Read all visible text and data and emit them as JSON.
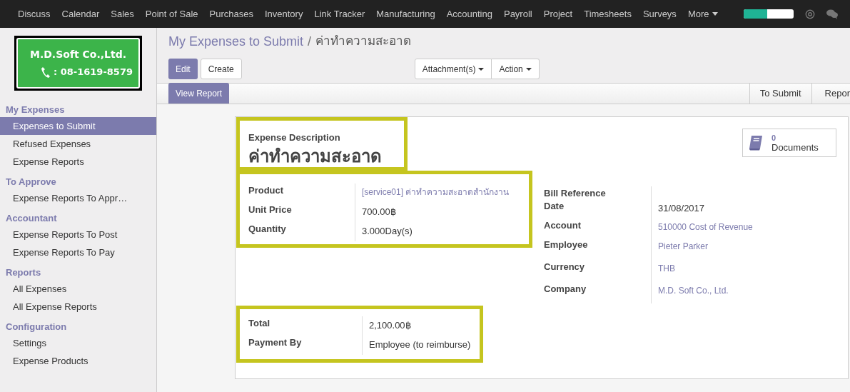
{
  "top_menu": {
    "items": [
      "Discuss",
      "Calendar",
      "Sales",
      "Point of Sale",
      "Purchases",
      "Inventory",
      "Link Tracker",
      "Manufacturing",
      "Accounting",
      "Payroll",
      "Project",
      "Timesheets",
      "Surveys"
    ],
    "more": "More",
    "progress": {
      "level": 0.48
    }
  },
  "logo": {
    "name": "M.D.Soft Co.,Ltd.",
    "phone": ": 08-1619-8579"
  },
  "sidebar": {
    "sections": [
      {
        "title": "My Expenses",
        "items": [
          {
            "label": "Expenses to Submit",
            "selected": true
          },
          {
            "label": "Refused Expenses",
            "selected": false
          },
          {
            "label": "Expense Reports",
            "selected": false
          }
        ]
      },
      {
        "title": "To Approve",
        "items": [
          {
            "label": "Expense Reports To Appr…",
            "selected": false
          }
        ]
      },
      {
        "title": "Accountant",
        "items": [
          {
            "label": "Expense Reports To Post",
            "selected": false
          },
          {
            "label": "Expense Reports To Pay",
            "selected": false
          }
        ]
      },
      {
        "title": "Reports",
        "items": [
          {
            "label": "All Expenses",
            "selected": false
          },
          {
            "label": "All Expense Reports",
            "selected": false
          }
        ]
      },
      {
        "title": "Configuration",
        "items": [
          {
            "label": "Settings",
            "selected": false
          },
          {
            "label": "Expense Products",
            "selected": false
          }
        ]
      }
    ]
  },
  "breadcrumb": {
    "parent": "My Expenses to Submit",
    "separator": "/",
    "current": "ค่าทำความสะอาด"
  },
  "buttons": {
    "edit": "Edit",
    "create": "Create",
    "dropdowns": [
      "Attachment(s)",
      "Action"
    ]
  },
  "statusbar": {
    "button": "View Report",
    "stages": [
      "To Submit",
      "Repor"
    ]
  },
  "form": {
    "description_label": "Expense Description",
    "description": "ค่าทำความสะอาด",
    "smart_button": {
      "count": "0",
      "label": "Documents"
    },
    "left_fields": [
      {
        "label": "Product",
        "value": "[service01] ค่าทำความสะอาดสำนักงาน",
        "kind": "link"
      },
      {
        "label": "Unit Price",
        "value": "700.00฿",
        "kind": "text"
      },
      {
        "label": "Quantity",
        "value": "3.000Day(s)",
        "kind": "text"
      }
    ],
    "right_fields": [
      {
        "label": "Bill Reference",
        "kind": "empty"
      },
      {
        "label": "Date",
        "value": "31/08/2017",
        "kind": "text"
      },
      {
        "label": "Account",
        "value": "510000 Cost of Revenue",
        "kind": "link"
      },
      {
        "label": "Employee",
        "value": "Pieter Parker",
        "kind": "link"
      },
      {
        "label": "Currency",
        "value": "THB",
        "kind": "link"
      },
      {
        "label": "Company",
        "value": "M.D. Soft Co., Ltd.",
        "kind": "link"
      }
    ],
    "total_fields": [
      {
        "label": "Total",
        "value": "2,100.00฿",
        "kind": "text"
      },
      {
        "label": "Payment By",
        "value": "Employee (to reimburse)",
        "kind": "text"
      }
    ]
  }
}
